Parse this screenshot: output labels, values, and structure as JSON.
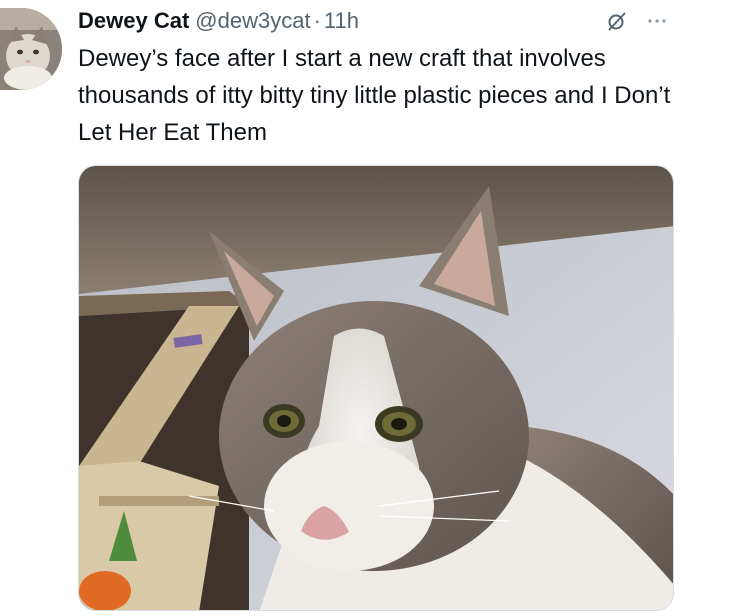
{
  "tweet": {
    "display_name": "Dewey Cat",
    "handle": "@dew3ycat",
    "separator": "·",
    "time": "11h",
    "text": "Dewey’s face after I start a new craft that involves thousands of itty bitty tiny little plastic pieces and I Don’t Let Her Eat Them"
  },
  "icons": {
    "avatar": "avatar-cat-photo",
    "grok": "slashed-circle-icon",
    "more": "more-dots-icon"
  },
  "media": {
    "subject": "cat-photo"
  },
  "colors": {
    "text": "#0f1419",
    "secondary": "#536471",
    "border": "#d7dce0"
  }
}
